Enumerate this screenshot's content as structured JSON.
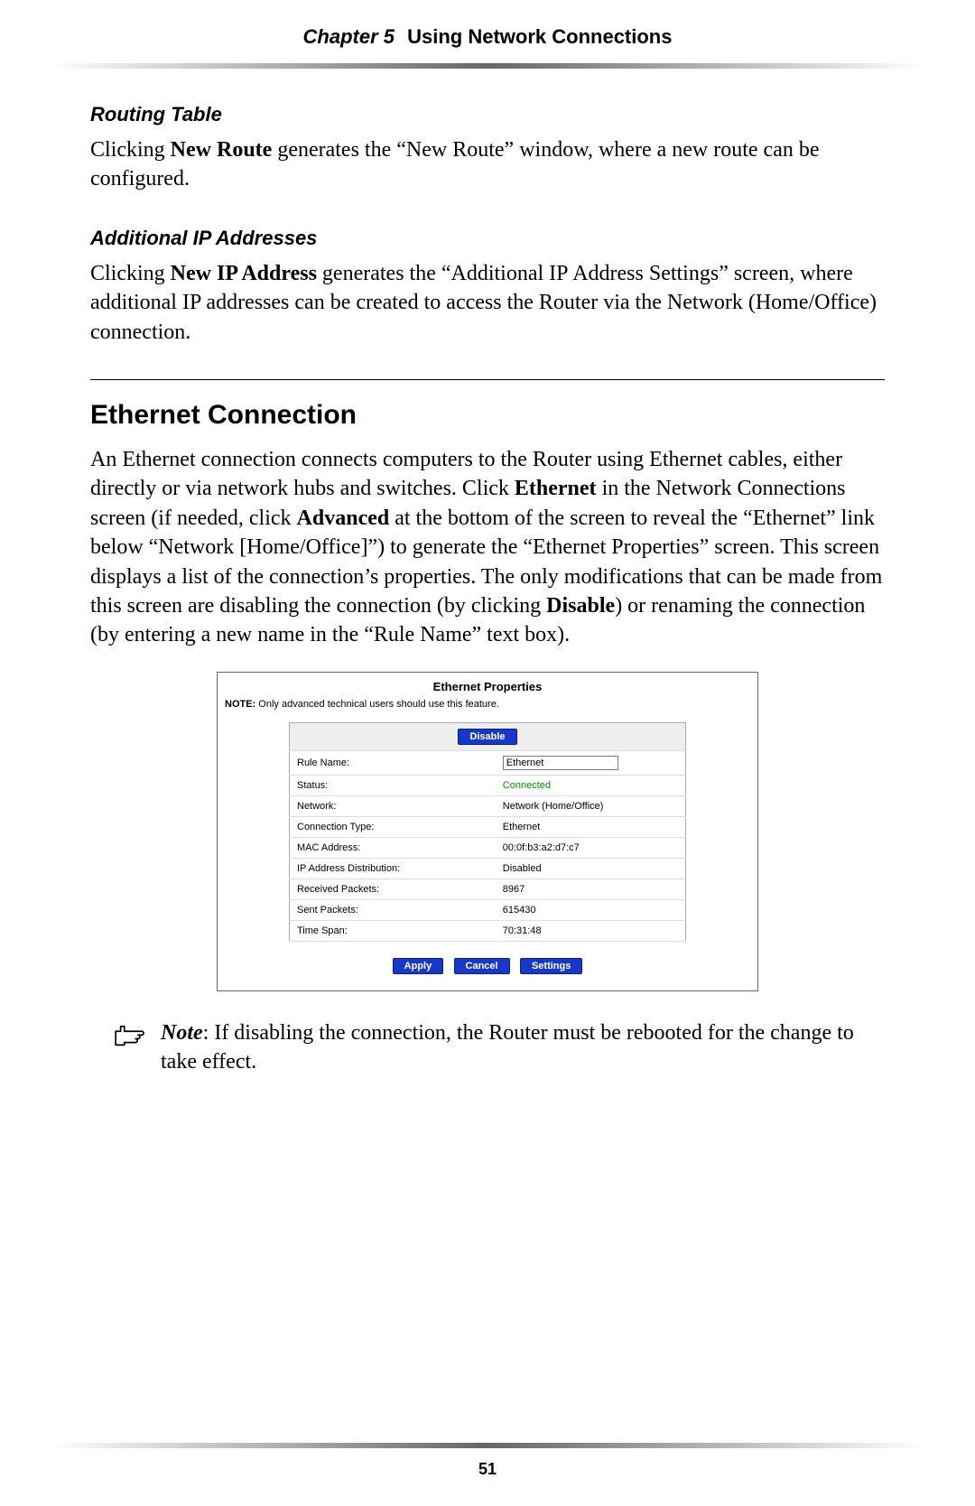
{
  "header": {
    "chapter": "Chapter 5",
    "title": "Using Network Connections"
  },
  "routing": {
    "heading": "Routing Table",
    "p1_a": "Clicking ",
    "p1_b": "New Route",
    "p1_c": " generates the “New Route” window, where a new route can be configured."
  },
  "additional_ip": {
    "heading": "Additional IP Addresses",
    "p1_a": "Clicking ",
    "p1_b": "New IP Address",
    "p1_c": " generates the “Additional ",
    "p1_d": "IP",
    "p1_e": " Address Settings” screen, where additional IP addresses can be created to access the Router via the Network (Home/Office) connection."
  },
  "ethernet": {
    "heading": "Ethernet Connection",
    "p1_a": "An Ethernet connection connects computers to the Router using Ethernet cables, either directly or via network hubs and switches. Click ",
    "p1_b": "Ethernet",
    "p1_c": " in the Network Connections screen (if needed, click ",
    "p1_d": "Advanced",
    "p1_e": " at the bottom of the screen to reveal the “Ethernet” link below “Network [Home/Office]”) to generate the “Ethernet Properties” screen. This screen displays a list of the connection’s properties. The only modifications that can be made from this screen are disabling the connection (by clicking ",
    "p1_f": "Disable",
    "p1_g": ") or renaming the connection (by entering a new name in the “Rule Name” text box)."
  },
  "panel": {
    "title": "Ethernet Properties",
    "note_b": "NOTE:",
    "note": " Only advanced technical users should use this feature.",
    "disable_btn": "Disable",
    "rows": [
      {
        "label": "Rule Name:",
        "value": "Ethernet"
      },
      {
        "label": "Status:",
        "value": "Connected"
      },
      {
        "label": "Network:",
        "value": "Network (Home/Office)"
      },
      {
        "label": "Connection Type:",
        "value": "Ethernet"
      },
      {
        "label": "MAC Address:",
        "value": "00:0f:b3:a2:d7:c7"
      },
      {
        "label": "IP Address Distribution:",
        "value": "Disabled"
      },
      {
        "label": "Received Packets:",
        "value": "8967"
      },
      {
        "label": "Sent Packets:",
        "value": "615430"
      },
      {
        "label": "Time Span:",
        "value": "70:31:48"
      }
    ],
    "buttons": {
      "apply": "Apply",
      "cancel": "Cancel",
      "settings": "Settings"
    }
  },
  "note_block": {
    "label": "Note",
    "text": ": If disabling the connection, the Router must be rebooted for the change to take effect."
  },
  "page_number": "51"
}
